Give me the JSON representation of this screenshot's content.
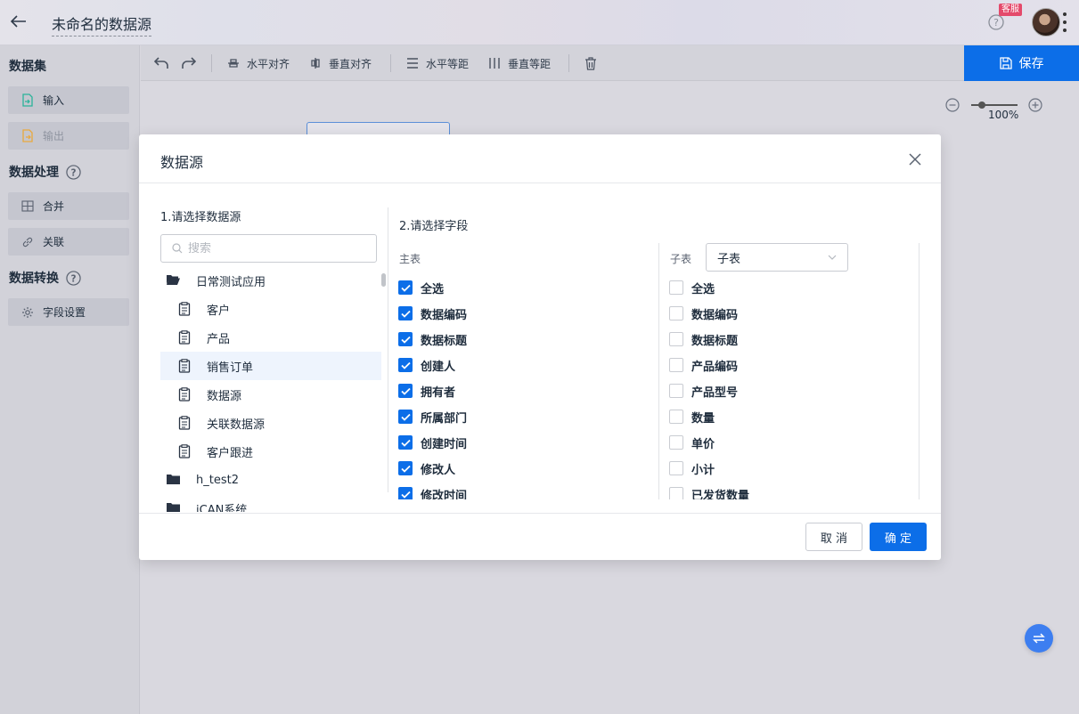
{
  "header": {
    "title": "未命名的数据源",
    "service_badge": "客服"
  },
  "sidebar": {
    "section_dataset": "数据集",
    "input_label": "输入",
    "output_label": "输出",
    "section_processing": "数据处理",
    "merge_label": "合并",
    "relate_label": "关联",
    "section_transform": "数据转换",
    "field_settings_label": "字段设置"
  },
  "toolbar": {
    "h_align": "水平对齐",
    "v_align": "垂直对齐",
    "h_distribute": "水平等距",
    "v_distribute": "垂直等距",
    "save": "保存"
  },
  "canvas": {
    "zoom_label": "100%"
  },
  "modal": {
    "title": "数据源",
    "step1_label": "1.请选择数据源",
    "search_placeholder": "搜索",
    "tree": [
      {
        "label": "日常测试应用",
        "type": "folder-open",
        "level": 0
      },
      {
        "label": "客户",
        "type": "form",
        "level": 1
      },
      {
        "label": "产品",
        "type": "form",
        "level": 1
      },
      {
        "label": "销售订单",
        "type": "form",
        "level": 1,
        "selected": true
      },
      {
        "label": "数据源",
        "type": "form",
        "level": 1
      },
      {
        "label": "关联数据源",
        "type": "form",
        "level": 1
      },
      {
        "label": "客户跟进",
        "type": "form",
        "level": 1
      },
      {
        "label": "h_test2",
        "type": "folder",
        "level": 0
      },
      {
        "label": "iCAN系统",
        "type": "folder",
        "level": 0
      }
    ],
    "step2_label": "2.请选择字段",
    "main_table_label": "主表",
    "main_fields": [
      {
        "label": "全选",
        "checked": true
      },
      {
        "label": "数据编码",
        "checked": true
      },
      {
        "label": "数据标题",
        "checked": true
      },
      {
        "label": "创建人",
        "checked": true
      },
      {
        "label": "拥有者",
        "checked": true
      },
      {
        "label": "所属部门",
        "checked": true
      },
      {
        "label": "创建时间",
        "checked": true
      },
      {
        "label": "修改人",
        "checked": true
      },
      {
        "label": "修改时间",
        "checked": true
      }
    ],
    "sub_table_label": "子表",
    "sub_table_select": "子表",
    "sub_fields": [
      {
        "label": "全选",
        "checked": false
      },
      {
        "label": "数据编码",
        "checked": false
      },
      {
        "label": "数据标题",
        "checked": false
      },
      {
        "label": "产品编码",
        "checked": false
      },
      {
        "label": "产品型号",
        "checked": false
      },
      {
        "label": "数量",
        "checked": false
      },
      {
        "label": "单价",
        "checked": false
      },
      {
        "label": "小计",
        "checked": false
      },
      {
        "label": "已发货数量",
        "checked": false
      }
    ],
    "cancel": "取 消",
    "confirm": "确 定"
  },
  "colors": {
    "primary": "#0c6ee8",
    "badge": "#e44a6b",
    "float_button": "#3d7ef0"
  }
}
